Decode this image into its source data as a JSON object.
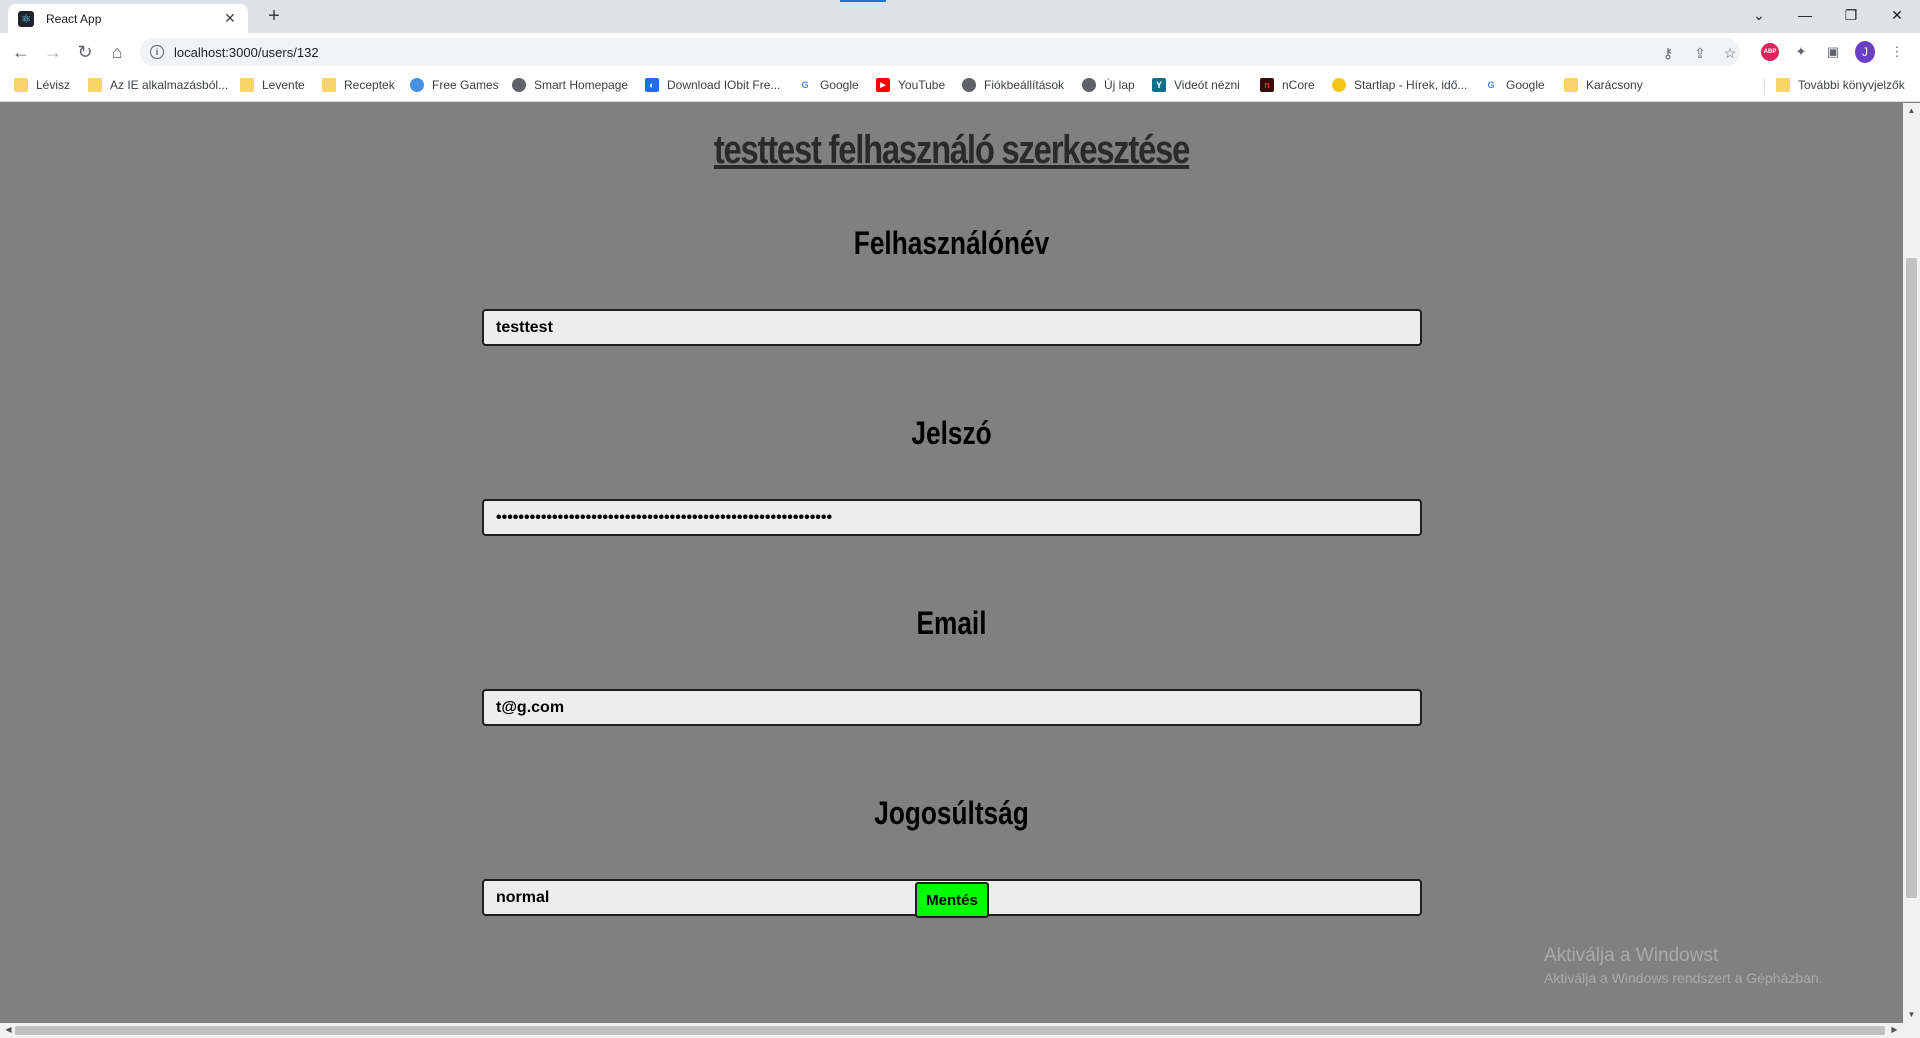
{
  "browser": {
    "tab_title": "React App",
    "url": "localhost:3000/users/132",
    "profile_initial": "J",
    "bookmarks": [
      {
        "label": "Lévisz",
        "icon": "folder-icon"
      },
      {
        "label": "Az IE alkalmazásból...",
        "icon": "folder-icon"
      },
      {
        "label": "Levente",
        "icon": "folder-icon"
      },
      {
        "label": "Receptek",
        "icon": "folder-icon"
      },
      {
        "label": "Free Games",
        "icon": "globe-icon"
      },
      {
        "label": "Smart Homepage",
        "icon": "globe-icon"
      },
      {
        "label": "Download IObit Fre...",
        "icon": "iobit-icon"
      },
      {
        "label": "Google",
        "icon": "google-icon"
      },
      {
        "label": "YouTube",
        "icon": "youtube-icon"
      },
      {
        "label": "Fiókbeállítások",
        "icon": "globe-icon"
      },
      {
        "label": "Új lap",
        "icon": "globe-icon"
      },
      {
        "label": "Videót nézni",
        "icon": "y-icon"
      },
      {
        "label": "nCore",
        "icon": "ncore-icon"
      },
      {
        "label": "Startlap - Hírek, idő...",
        "icon": "startlap-icon"
      },
      {
        "label": "Google",
        "icon": "google-icon"
      },
      {
        "label": "Karácsony",
        "icon": "folder-icon"
      }
    ],
    "other_bookmarks": "További könyvjelzők"
  },
  "page": {
    "title": "testtest felhasználó szerkesztése",
    "fields": [
      {
        "label": "Felhasználónév",
        "value": "testtest"
      },
      {
        "label": "Jelszó",
        "value": "••••••••••••••••••••••••••••••••••••••••••••••••••••••••••••"
      },
      {
        "label": "Email",
        "value": "t@g.com"
      },
      {
        "label": "Jogosúltság",
        "value": "normal"
      }
    ],
    "save_label": "Mentés"
  },
  "watermark": {
    "title": "Aktiválja a Windowst",
    "subtitle": "Aktiválja a Windows rendszert a Gépházban."
  }
}
